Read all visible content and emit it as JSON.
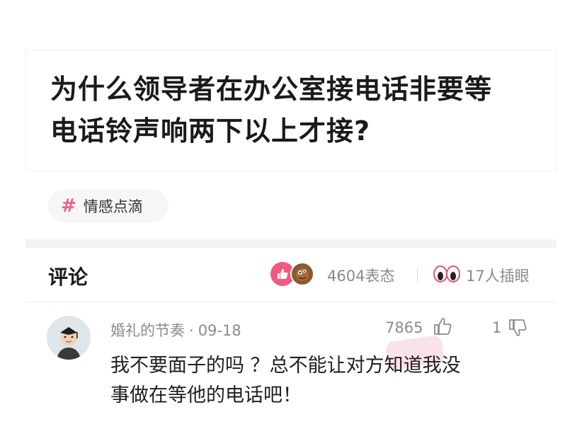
{
  "post": {
    "title_line1": "为什么领导者在办公室接电话非要等",
    "title_line2": "电话铃声响两下以上才接?"
  },
  "tag": {
    "symbol": "#",
    "label": "情感点滴"
  },
  "comments_header": {
    "title": "评论",
    "reaction_count": "4604表态",
    "insert_count": "17人插眼"
  },
  "comment": {
    "author": "婚礼的节奏",
    "separator": "·",
    "date": "09-18",
    "likes": "7865",
    "dislikes": "1",
    "text_line1": "我不要面子的吗 ？总不能让对方知道我没",
    "text_line2": "事做在等他的电话吧！"
  },
  "colors": {
    "accent_pink": "#f05a7e",
    "tag_hash": "#e8628c",
    "meta_gray": "#8c8c8c"
  },
  "icons": [
    "hash-icon",
    "like-reaction-icon",
    "emoji-reaction-icon",
    "eyes-icon",
    "thumb-up-icon",
    "thumb-down-icon",
    "avatar"
  ]
}
